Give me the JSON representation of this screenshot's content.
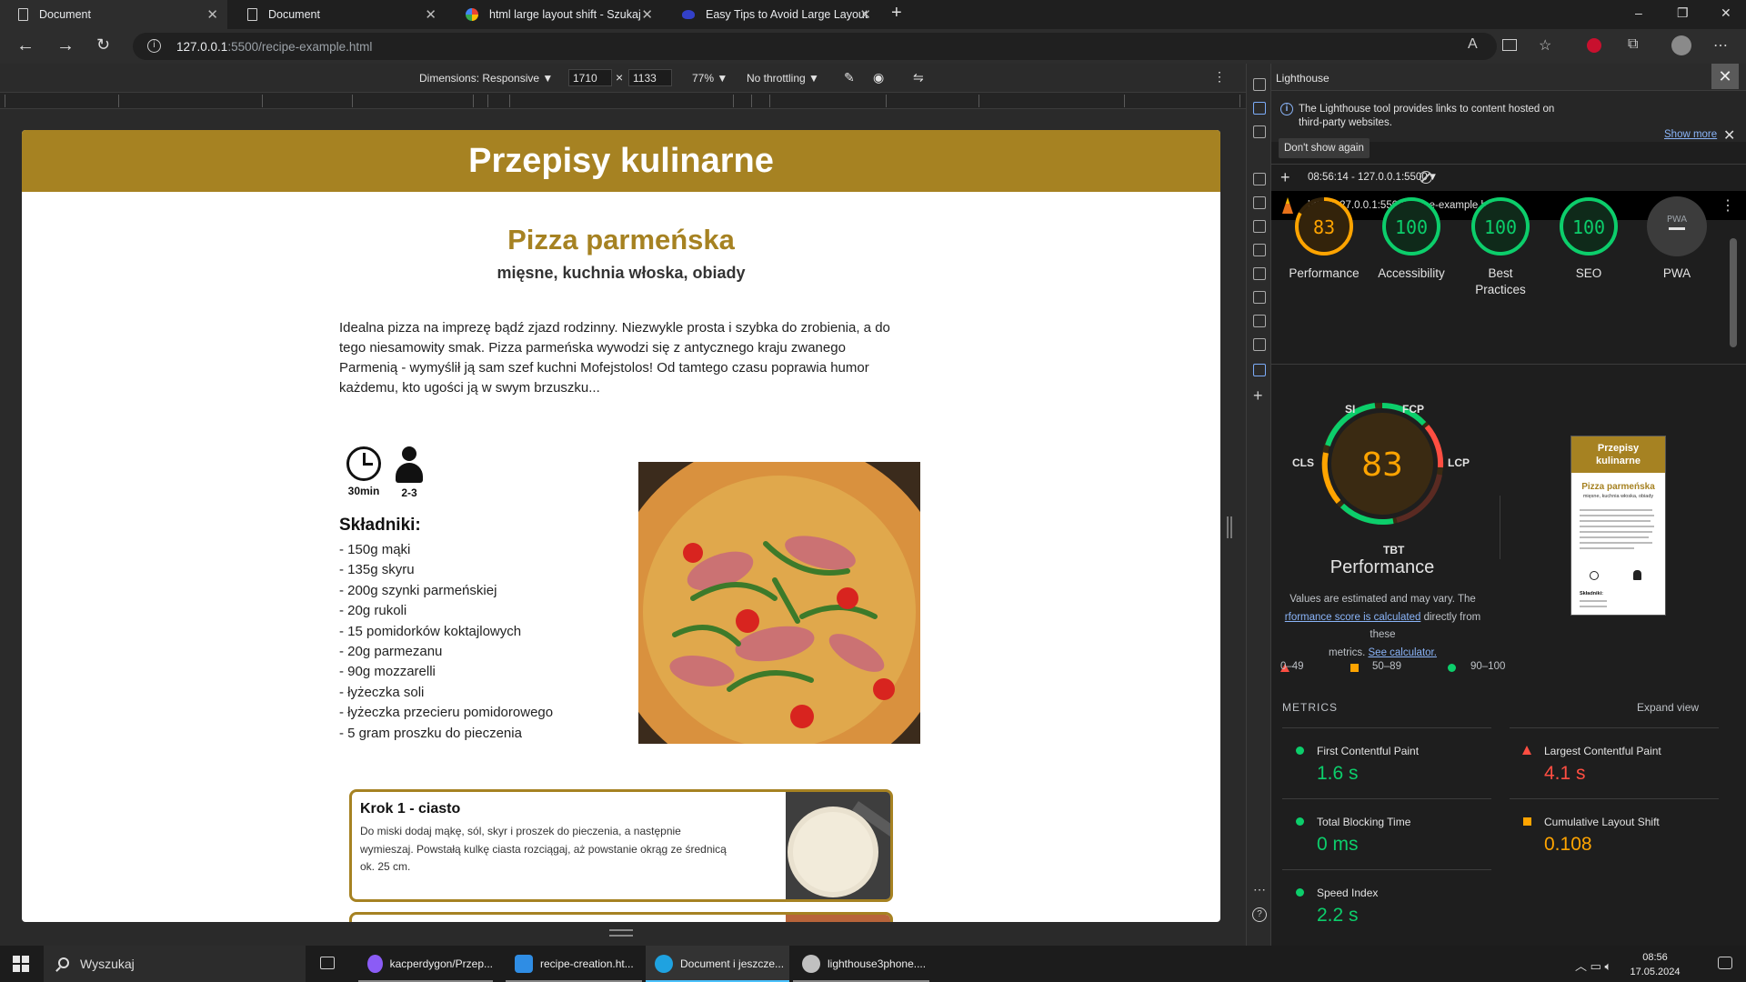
{
  "browser": {
    "tabs": [
      {
        "label": "Document",
        "icon": "document-icon"
      },
      {
        "label": "Document",
        "icon": "document-icon"
      },
      {
        "label": "html large layout shift - Szukaj w",
        "icon": "google-icon"
      },
      {
        "label": "Easy Tips to Avoid Large Layout",
        "icon": "bing-icon"
      }
    ],
    "url_host": "127.0.0.1",
    "url_path": ":5500/recipe-example.html",
    "new_tab": "+",
    "win_min": "–",
    "win_max": "❐",
    "win_close": "✕"
  },
  "device_toolbar": {
    "dimensions": "Dimensions: Responsive",
    "width": "1710",
    "times": "×",
    "height": "1133",
    "zoom": "77%",
    "throttling": "No throttling"
  },
  "page": {
    "site_title": "Przepisy kulinarne",
    "recipe_title": "Pizza parmeńska",
    "recipe_tags": "mięsne, kuchnia włoska, obiady",
    "description": "Idealna pizza na imprezę bądź zjazd rodzinny. Niezwykle prosta i szybka do zrobienia, a do tego niesamowity smak. Pizza parmeńska wywodzi się z antycznego kraju zwanego Parmenią - wymyślił ją sam szef kuchni Mofejstolos! Od tamtego czasu poprawia humor każdemu, kto ugości ją w swym brzuszku...",
    "time": "30min",
    "servings": "2-3",
    "ingredients_title": "Składniki:",
    "ingredients": [
      "- 150g mąki",
      "- 135g skyru",
      "- 200g szynki parmeńskiej",
      "- 20g rukoli",
      "- 15 pomidorków koktajlowych",
      "- 20g parmezanu",
      "- 90g mozzarelli",
      "- łyżeczka soli",
      "- łyżeczka przecieru pomidorowego",
      "- 5 gram proszku do pieczenia"
    ],
    "step1_title": "Krok 1 - ciasto",
    "step1_text": "Do miski dodaj mąkę, sól, skyr i proszek do pieczenia, a następnie wymieszaj. Powstałą kulkę ciasta rozciągaj, aż powstanie okrąg ze średnicą ok. 25 cm."
  },
  "devtools": {
    "panel_title": "Lighthouse",
    "info_text": "The Lighthouse tool provides links to content hosted on third-party websites.",
    "show_more": "Show more",
    "dont_show": "Don't show again",
    "report_select": "08:56:14 - 127.0.0.1:5500",
    "report_url": "http://127.0.0.1:5500/recipe-example.html",
    "scores": [
      {
        "label": "Performance",
        "value": 83,
        "display": "83",
        "color": "#ffa400"
      },
      {
        "label": "Accessibility",
        "value": 100,
        "display": "100",
        "color": "#0cce6b"
      },
      {
        "label": "Best Practices",
        "value": 100,
        "display": "100",
        "color": "#0cce6b"
      },
      {
        "label": "SEO",
        "value": 100,
        "display": "100",
        "color": "#0cce6b"
      },
      {
        "label": "PWA",
        "value": null,
        "display": "PWA",
        "color": "#9aa0a6"
      }
    ],
    "gauge_tags": {
      "si": "SI",
      "fcp": "FCP",
      "cls": "CLS",
      "lcp": "LCP",
      "tbt": "TBT"
    },
    "perf_score": "83",
    "perf_title": "Performance",
    "note_1": "Values are estimated and may vary. The",
    "note_link": "rformance score is calculated",
    "note_2": "directly from these",
    "note_3": "metrics.",
    "note_calc": "See calculator.",
    "legend": {
      "low": "0–49",
      "mid": "50–89",
      "high": "90–100"
    },
    "metrics_heading": "METRICS",
    "expand_view": "Expand view",
    "metrics": [
      {
        "name": "First Contentful Paint",
        "value": "1.6 s",
        "status": "pass",
        "color": "#0cce6b"
      },
      {
        "name": "Largest Contentful Paint",
        "value": "4.1 s",
        "status": "fail",
        "color": "#ff4e42"
      },
      {
        "name": "Total Blocking Time",
        "value": "0 ms",
        "status": "pass",
        "color": "#0cce6b"
      },
      {
        "name": "Cumulative Layout Shift",
        "value": "0.108",
        "status": "average",
        "color": "#ffa400"
      },
      {
        "name": "Speed Index",
        "value": "2.2 s",
        "status": "pass",
        "color": "#0cce6b"
      }
    ],
    "thumb": {
      "title": "Przepisy kulinarne",
      "recipe": "Pizza parmeńska",
      "tags": "mięsne, kuchnia włoska, obiady",
      "ingredients": "Składniki:"
    }
  },
  "taskbar": {
    "search": "Wyszukaj",
    "apps": [
      {
        "label": "kacperdygon/Przep...",
        "color": "#8b5cf6"
      },
      {
        "label": "recipe-creation.ht...",
        "color": "#2f8de4"
      },
      {
        "label": "Document i jeszcze...",
        "color": "#1fa2e0"
      },
      {
        "label": "lighthouse3phone....",
        "color": "#c0c0c0"
      }
    ],
    "time": "08:56",
    "date": "17.05.2024"
  }
}
